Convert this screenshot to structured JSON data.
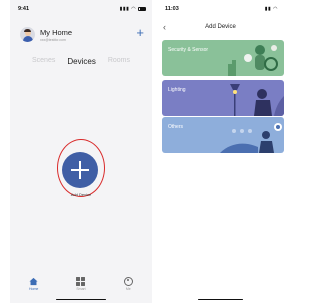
{
  "left_screen": {
    "status": {
      "time": "9:41"
    },
    "header": {
      "home_name": "My Home",
      "email": "xxx@testfor.com",
      "add_icon": "plus-icon"
    },
    "tabs": [
      {
        "label": "Scenes",
        "active": false
      },
      {
        "label": "Devices",
        "active": true
      },
      {
        "label": "Rooms",
        "active": false
      }
    ],
    "add_device": {
      "label": "Add Device",
      "icon": "plus-icon"
    },
    "tabbar": [
      {
        "label": "Home",
        "icon": "home-icon",
        "active": true
      },
      {
        "label": "Smart",
        "icon": "grid-icon",
        "active": false
      },
      {
        "label": "Me",
        "icon": "profile-icon",
        "active": false
      }
    ],
    "colors": {
      "accent": "#3f5ea5",
      "highlight_ring": "#d92b2b"
    }
  },
  "right_screen": {
    "status": {
      "time": "11:03"
    },
    "header": {
      "title": "Add Device",
      "back_icon": "chevron-left-icon"
    },
    "categories": [
      {
        "label": "Security & Sensor",
        "color": "#8ac199"
      },
      {
        "label": "Lighting",
        "color": "#7a7ec4"
      },
      {
        "label": "Others",
        "color": "#8eaedb"
      }
    ]
  }
}
